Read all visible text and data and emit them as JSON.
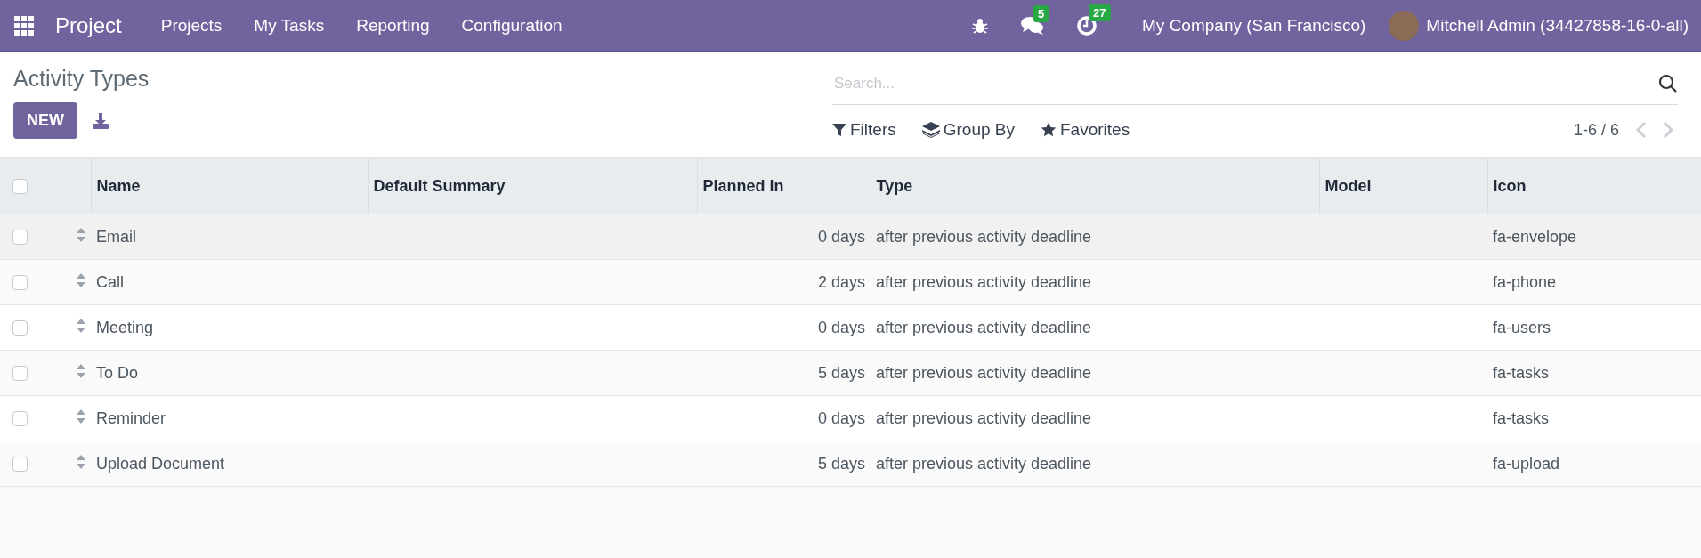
{
  "navbar": {
    "app_name": "Project",
    "menu": [
      "Projects",
      "My Tasks",
      "Reporting",
      "Configuration"
    ],
    "messages_badge": "5",
    "activities_badge": "27",
    "company": "My Company (San Francisco)",
    "user": "Mitchell Admin (34427858-16-0-all)"
  },
  "control_panel": {
    "title": "Activity Types",
    "new_button": "NEW",
    "search": {
      "placeholder": "Search..."
    },
    "filters": "Filters",
    "group_by": "Group By",
    "favorites": "Favorites",
    "pager": "1-6 / 6"
  },
  "table": {
    "select_all_checked": false,
    "columns": [
      "Name",
      "Default Summary",
      "Planned in",
      "Type",
      "Model",
      "Icon"
    ],
    "rows": [
      {
        "checked": false,
        "name": "Email",
        "planned_in": "0 days",
        "type": "after previous activity deadline",
        "icon": "fa-envelope"
      },
      {
        "checked": false,
        "name": "Call",
        "planned_in": "2 days",
        "type": "after previous activity deadline",
        "icon": "fa-phone"
      },
      {
        "checked": false,
        "name": "Meeting",
        "planned_in": "0 days",
        "type": "after previous activity deadline",
        "icon": "fa-users"
      },
      {
        "checked": false,
        "name": "To Do",
        "planned_in": "5 days",
        "type": "after previous activity deadline",
        "icon": "fa-tasks"
      },
      {
        "checked": false,
        "name": "Reminder",
        "planned_in": "0 days",
        "type": "after previous activity deadline",
        "icon": "fa-tasks"
      },
      {
        "checked": false,
        "name": "Upload Document",
        "planned_in": "5 days",
        "type": "after previous activity deadline",
        "icon": "fa-upload"
      }
    ]
  }
}
